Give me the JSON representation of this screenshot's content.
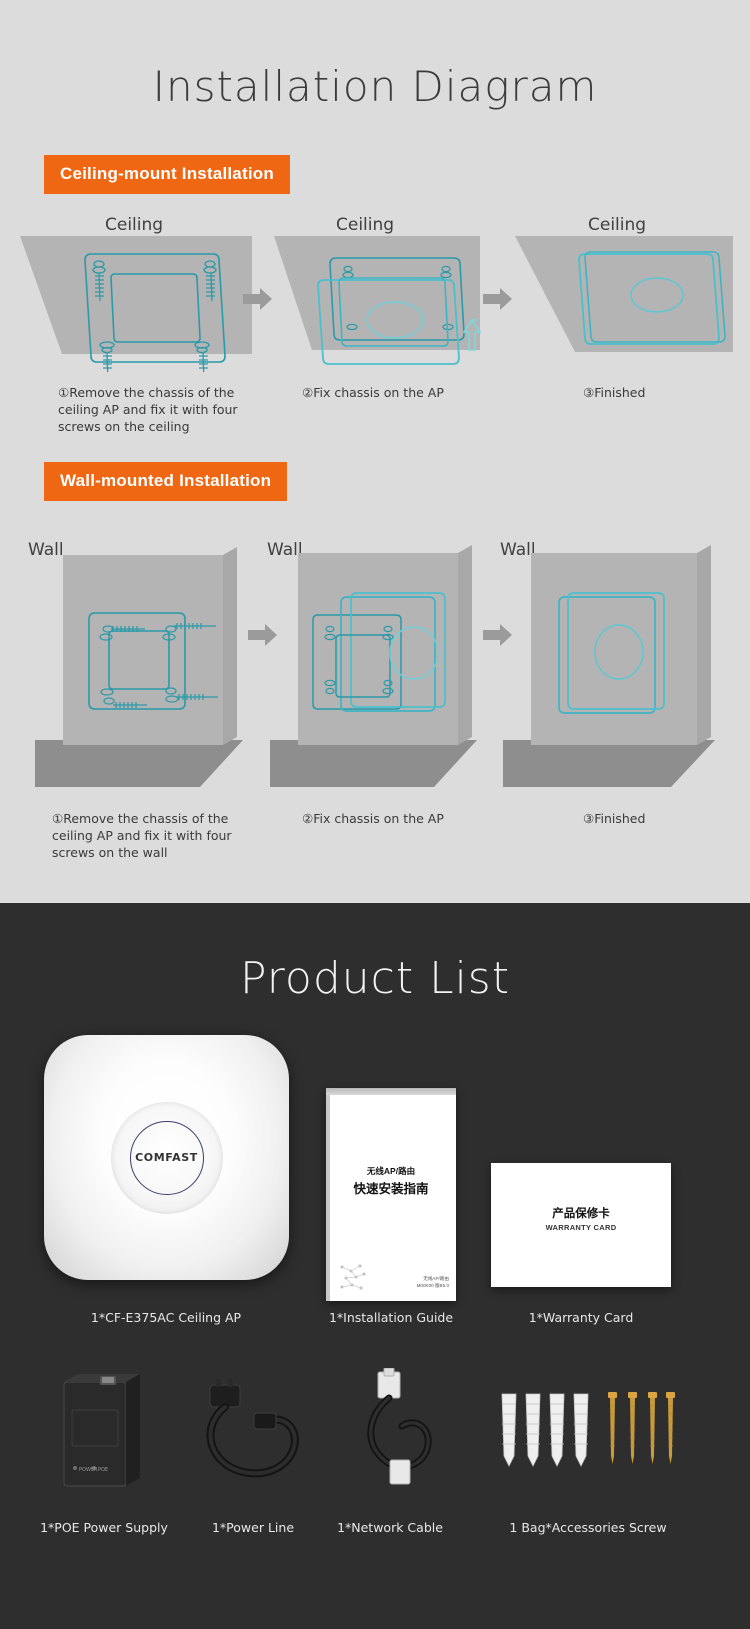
{
  "install": {
    "title": "Installation Diagram",
    "ceiling": {
      "badge": "Ceiling-mount Installation",
      "surface_label": "Ceiling",
      "steps": [
        "①Remove the chassis of the ceiling AP and fix it with four screws on the ceiling",
        "②Fix chassis on the AP",
        "③Finished"
      ]
    },
    "wall": {
      "badge": "Wall-mounted Installation",
      "surface_label": "Wall",
      "steps": [
        "①Remove the chassis of the ceiling AP and fix it with four screws on the wall",
        "②Fix chassis on the AP",
        "③Finished"
      ]
    }
  },
  "product": {
    "title": "Product List",
    "items": [
      {
        "caption": "1*CF-E375AC Ceiling AP"
      },
      {
        "caption": "1*Installation Guide"
      },
      {
        "caption": "1*Warranty Card"
      },
      {
        "caption": "1*POE Power Supply"
      },
      {
        "caption": "1*Power Line"
      },
      {
        "caption": "1*Network Cable"
      },
      {
        "caption": "1 Bag*Accessories Screw"
      }
    ],
    "ap_logo": "COMFAST",
    "booklet": {
      "subtitle": "无线AP/路由",
      "title": "快速安装指南",
      "footer_line1": "无线AP/路由",
      "footer_line2": "M00K00 版B5.0"
    },
    "warranty": {
      "title_cn": "产品保修卡",
      "title_en": "WARRANTY CARD"
    }
  },
  "colors": {
    "accent_orange": "#ef6712",
    "diagram_teal": "#2a9aa8",
    "panel_gray": "#b4b4b4",
    "section_dark": "#2e2e2e",
    "section_light": "#dcdcdc"
  }
}
